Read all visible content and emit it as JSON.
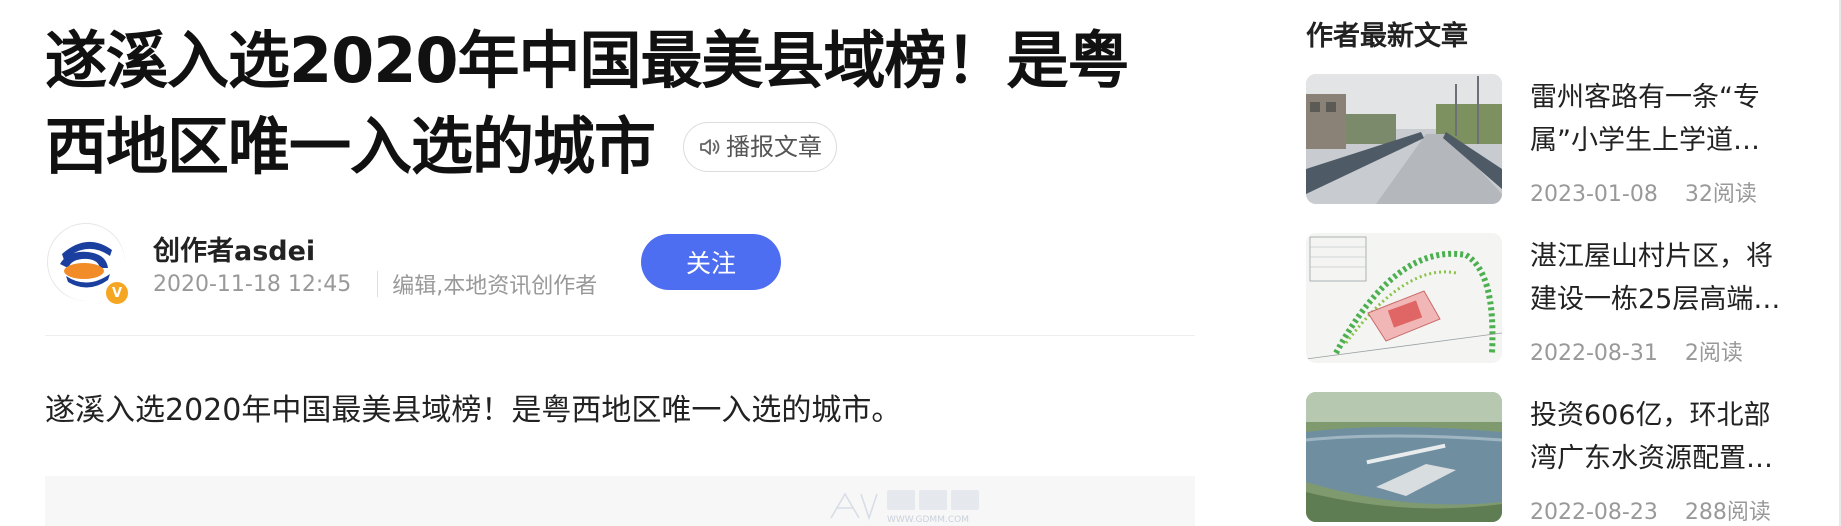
{
  "article": {
    "title_line1": "遂溪入选2020年中国最美县域榜！是粤",
    "title_line2": "西地区唯一入选的城市",
    "listen_label": "播报文章",
    "summary": "遂溪入选2020年中国最美县域榜！是粤西地区唯一入选的城市。",
    "watermark_text": "WWW.GDMM.COM"
  },
  "author": {
    "name": "创作者asdei",
    "date": "2020-11-18 12:45",
    "role": "编辑,本地资讯创作者",
    "badge": "V",
    "follow_label": "关注"
  },
  "sidebar": {
    "title": "作者最新文章",
    "items": [
      {
        "title": "雷州客路有一条“专属”小学生上学道…",
        "date": "2023-01-08",
        "reads": "32阅读"
      },
      {
        "title": "湛江屋山村片区，将建设一栋25层高端…",
        "date": "2022-08-31",
        "reads": "2阅读"
      },
      {
        "title": "投资606亿，环北部湾广东水资源配置…",
        "date": "2022-08-23",
        "reads": "288阅读"
      }
    ]
  },
  "icons": {
    "listen": "speaker-icon",
    "verified": "verified-badge-icon"
  },
  "colors": {
    "follow_button": "#4e6ef2",
    "badge": "#f5a623",
    "muted_text": "#999999"
  }
}
